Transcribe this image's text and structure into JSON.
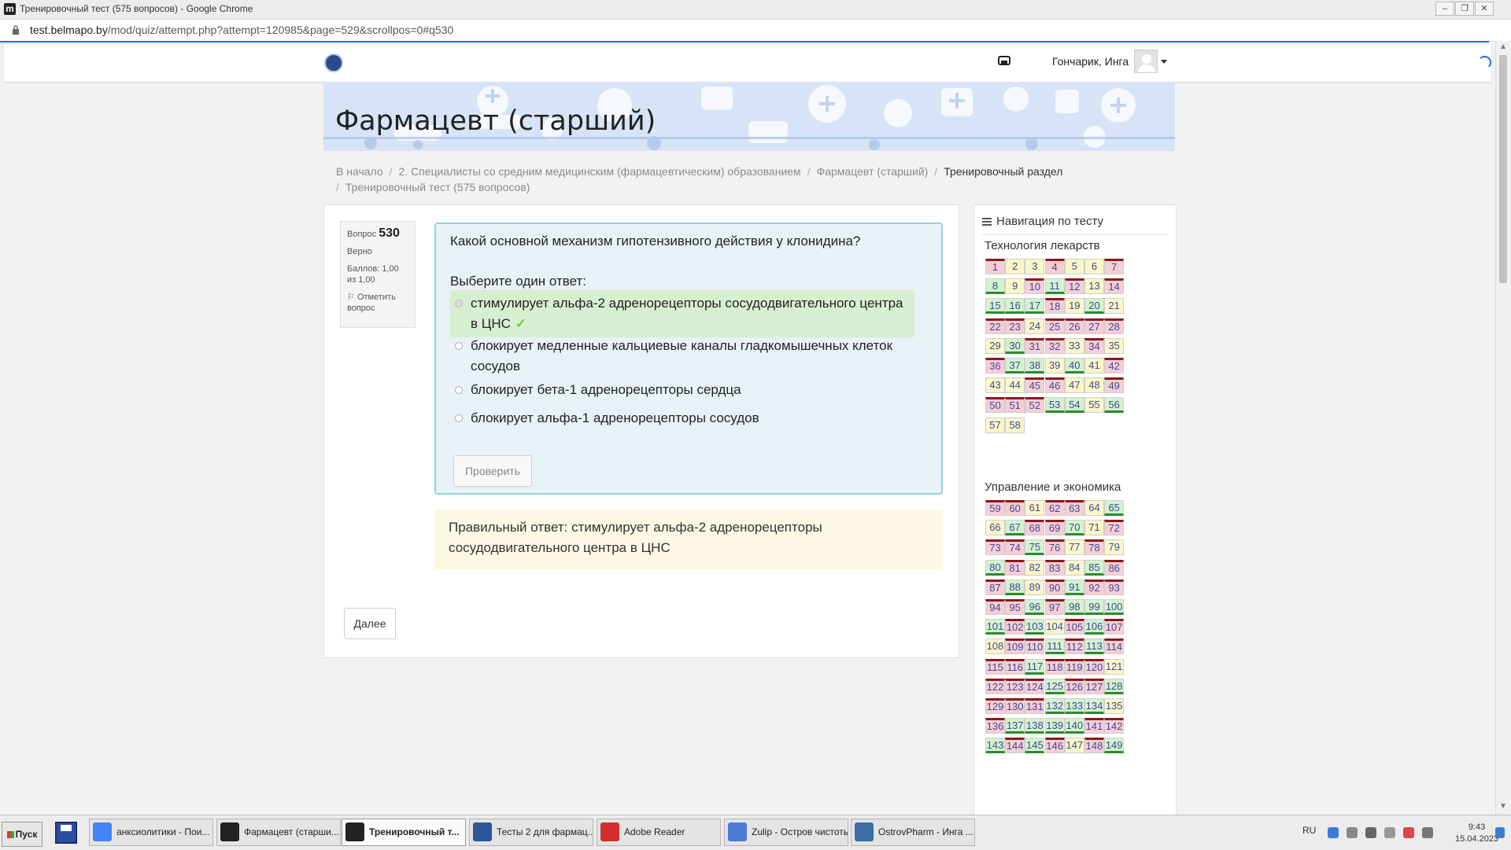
{
  "browser": {
    "window_title": "Тренировочный тест (575 вопросов) - Google Chrome",
    "favicon_letter": "m",
    "url_host": "test.belmapo.by",
    "url_path": "/mod/quiz/attempt.php?attempt=120985&page=529&scrollpos=0#q530"
  },
  "header": {
    "username": "Гончарик, Инга"
  },
  "banner": {
    "title": "Фармацевт (старший)"
  },
  "breadcrumb": [
    "В начало",
    "2. Специалисты со средним медицинским (фармацевтическим) образованием",
    "Фармацевт (старший)",
    "Тренировочный раздел",
    "Тренировочный тест (575 вопросов)"
  ],
  "question_info": {
    "label": "Вопрос",
    "number": "530",
    "status": "Верно",
    "score": "Баллов: 1,00 из 1,00",
    "flag": "Отметить вопрос"
  },
  "question": {
    "text": "Какой основной механизм гипотензивного действия у клонидина?",
    "prompt": "Выберите один ответ:",
    "options": [
      "стимулирует альфа-2 адренорецепторы сосудодвигательного центра в ЦНС",
      "блокирует медленные кальциевые каналы гладкомышечных клеток сосудов",
      "блокирует бета-1 адренорецепторы сердца",
      "блокирует альфа-1 адренорецепторы сосудов"
    ],
    "check_button": "Проверить",
    "feedback": "Правильный ответ: стимулирует альфа-2 адренорецепторы сосудодвигательного центра в ЦНС",
    "next_button": "Далее"
  },
  "navigation": {
    "title": "Навигация по тесту",
    "sections": [
      {
        "label": "Технология лекарств",
        "cells": [
          {
            "n": "1",
            "s": "r"
          },
          {
            "n": "2",
            "s": "y"
          },
          {
            "n": "3",
            "s": "y"
          },
          {
            "n": "4",
            "s": "r"
          },
          {
            "n": "5",
            "s": "y"
          },
          {
            "n": "6",
            "s": "y"
          },
          {
            "n": "7",
            "s": "r"
          },
          {
            "n": "8",
            "s": "g"
          },
          {
            "n": "9",
            "s": "y"
          },
          {
            "n": "10",
            "s": "r"
          },
          {
            "n": "11",
            "s": "g"
          },
          {
            "n": "12",
            "s": "r"
          },
          {
            "n": "13",
            "s": "y"
          },
          {
            "n": "14",
            "s": "r"
          },
          {
            "n": "15",
            "s": "g"
          },
          {
            "n": "16",
            "s": "g"
          },
          {
            "n": "17",
            "s": "g"
          },
          {
            "n": "18",
            "s": "r"
          },
          {
            "n": "19",
            "s": "y"
          },
          {
            "n": "20",
            "s": "g"
          },
          {
            "n": "21",
            "s": "y"
          },
          {
            "n": "22",
            "s": "r"
          },
          {
            "n": "23",
            "s": "r"
          },
          {
            "n": "24",
            "s": "y"
          },
          {
            "n": "25",
            "s": "r"
          },
          {
            "n": "26",
            "s": "r"
          },
          {
            "n": "27",
            "s": "r"
          },
          {
            "n": "28",
            "s": "r"
          },
          {
            "n": "29",
            "s": "y"
          },
          {
            "n": "30",
            "s": "g"
          },
          {
            "n": "31",
            "s": "r"
          },
          {
            "n": "32",
            "s": "r"
          },
          {
            "n": "33",
            "s": "y"
          },
          {
            "n": "34",
            "s": "r"
          },
          {
            "n": "35",
            "s": "y"
          },
          {
            "n": "36",
            "s": "r"
          },
          {
            "n": "37",
            "s": "g"
          },
          {
            "n": "38",
            "s": "g"
          },
          {
            "n": "39",
            "s": "y"
          },
          {
            "n": "40",
            "s": "g"
          },
          {
            "n": "41",
            "s": "y"
          },
          {
            "n": "42",
            "s": "r"
          },
          {
            "n": "43",
            "s": "y"
          },
          {
            "n": "44",
            "s": "y"
          },
          {
            "n": "45",
            "s": "r"
          },
          {
            "n": "46",
            "s": "r"
          },
          {
            "n": "47",
            "s": "y"
          },
          {
            "n": "48",
            "s": "y"
          },
          {
            "n": "49",
            "s": "r"
          },
          {
            "n": "50",
            "s": "r"
          },
          {
            "n": "51",
            "s": "r"
          },
          {
            "n": "52",
            "s": "r"
          },
          {
            "n": "53",
            "s": "g"
          },
          {
            "n": "54",
            "s": "g"
          },
          {
            "n": "55",
            "s": "y"
          },
          {
            "n": "56",
            "s": "g"
          },
          {
            "n": "57",
            "s": "y"
          },
          {
            "n": "58",
            "s": "y"
          }
        ]
      },
      {
        "label": "Управление и экономика",
        "cells": [
          {
            "n": "59",
            "s": "r"
          },
          {
            "n": "60",
            "s": "r"
          },
          {
            "n": "61",
            "s": "y"
          },
          {
            "n": "62",
            "s": "r"
          },
          {
            "n": "63",
            "s": "r"
          },
          {
            "n": "64",
            "s": "y"
          },
          {
            "n": "65",
            "s": "g"
          },
          {
            "n": "66",
            "s": "y"
          },
          {
            "n": "67",
            "s": "g"
          },
          {
            "n": "68",
            "s": "r"
          },
          {
            "n": "69",
            "s": "r"
          },
          {
            "n": "70",
            "s": "g"
          },
          {
            "n": "71",
            "s": "y"
          },
          {
            "n": "72",
            "s": "r"
          },
          {
            "n": "73",
            "s": "r"
          },
          {
            "n": "74",
            "s": "r"
          },
          {
            "n": "75",
            "s": "g"
          },
          {
            "n": "76",
            "s": "r"
          },
          {
            "n": "77",
            "s": "y"
          },
          {
            "n": "78",
            "s": "r"
          },
          {
            "n": "79",
            "s": "y"
          },
          {
            "n": "80",
            "s": "g"
          },
          {
            "n": "81",
            "s": "r"
          },
          {
            "n": "82",
            "s": "y"
          },
          {
            "n": "83",
            "s": "r"
          },
          {
            "n": "84",
            "s": "y"
          },
          {
            "n": "85",
            "s": "g"
          },
          {
            "n": "86",
            "s": "r"
          },
          {
            "n": "87",
            "s": "r"
          },
          {
            "n": "88",
            "s": "g"
          },
          {
            "n": "89",
            "s": "y"
          },
          {
            "n": "90",
            "s": "r"
          },
          {
            "n": "91",
            "s": "g"
          },
          {
            "n": "92",
            "s": "r"
          },
          {
            "n": "93",
            "s": "r"
          },
          {
            "n": "94",
            "s": "r"
          },
          {
            "n": "95",
            "s": "r"
          },
          {
            "n": "96",
            "s": "g"
          },
          {
            "n": "97",
            "s": "r"
          },
          {
            "n": "98",
            "s": "g"
          },
          {
            "n": "99",
            "s": "g"
          },
          {
            "n": "100",
            "s": "g"
          },
          {
            "n": "101",
            "s": "g"
          },
          {
            "n": "102",
            "s": "r"
          },
          {
            "n": "103",
            "s": "g"
          },
          {
            "n": "104",
            "s": "y"
          },
          {
            "n": "105",
            "s": "r"
          },
          {
            "n": "106",
            "s": "g"
          },
          {
            "n": "107",
            "s": "r"
          },
          {
            "n": "108",
            "s": "y"
          },
          {
            "n": "109",
            "s": "r"
          },
          {
            "n": "110",
            "s": "r"
          },
          {
            "n": "111",
            "s": "g"
          },
          {
            "n": "112",
            "s": "r"
          },
          {
            "n": "113",
            "s": "g"
          },
          {
            "n": "114",
            "s": "r"
          },
          {
            "n": "115",
            "s": "r"
          },
          {
            "n": "116",
            "s": "r"
          },
          {
            "n": "117",
            "s": "g"
          },
          {
            "n": "118",
            "s": "r"
          },
          {
            "n": "119",
            "s": "r"
          },
          {
            "n": "120",
            "s": "r"
          },
          {
            "n": "121",
            "s": "y"
          },
          {
            "n": "122",
            "s": "r"
          },
          {
            "n": "123",
            "s": "r"
          },
          {
            "n": "124",
            "s": "r"
          },
          {
            "n": "125",
            "s": "g"
          },
          {
            "n": "126",
            "s": "r"
          },
          {
            "n": "127",
            "s": "r"
          },
          {
            "n": "128",
            "s": "g"
          },
          {
            "n": "129",
            "s": "r"
          },
          {
            "n": "130",
            "s": "r"
          },
          {
            "n": "131",
            "s": "r"
          },
          {
            "n": "132",
            "s": "g"
          },
          {
            "n": "133",
            "s": "g"
          },
          {
            "n": "134",
            "s": "g"
          },
          {
            "n": "135",
            "s": "y"
          },
          {
            "n": "136",
            "s": "r"
          },
          {
            "n": "137",
            "s": "g"
          },
          {
            "n": "138",
            "s": "g"
          },
          {
            "n": "139",
            "s": "g"
          },
          {
            "n": "140",
            "s": "g"
          },
          {
            "n": "141",
            "s": "r"
          },
          {
            "n": "142",
            "s": "r"
          },
          {
            "n": "143",
            "s": "g"
          },
          {
            "n": "144",
            "s": "r"
          },
          {
            "n": "145",
            "s": "g"
          },
          {
            "n": "146",
            "s": "r"
          },
          {
            "n": "147",
            "s": "y"
          },
          {
            "n": "148",
            "s": "r"
          },
          {
            "n": "149",
            "s": "g"
          }
        ]
      }
    ]
  },
  "taskbar": {
    "start": "Пуск",
    "tasks": [
      {
        "label": "анксиолитики - Пои...",
        "icon": "chrome-icon",
        "color": "#4285f4",
        "active": false
      },
      {
        "label": "Фармацевт (старши...",
        "icon": "moodle-icon",
        "color": "#222222",
        "active": false
      },
      {
        "label": "Тренировочный т...",
        "icon": "moodle-icon",
        "color": "#222222",
        "active": true
      },
      {
        "label": "Тесты 2 для фармац...",
        "icon": "word-icon",
        "color": "#2b5797",
        "active": false
      },
      {
        "label": "Adobe Reader",
        "icon": "adobe-reader-icon",
        "color": "#d32f2f",
        "active": false
      },
      {
        "label": "Zulip - Остров чистоты",
        "icon": "zulip-icon",
        "color": "#4a7bd8",
        "active": false
      },
      {
        "label": "OstrovPharm - Инга ...",
        "icon": "ostrovpharm-icon",
        "color": "#3a6ea5",
        "active": false
      }
    ],
    "lang": "RU",
    "time": "9:43",
    "date": "15.04.2023"
  },
  "colors": {
    "wrong": "#f6ced4",
    "correct": "#d4f2cf",
    "partial": "#fbf6c8",
    "accent": "#1a73e8"
  }
}
